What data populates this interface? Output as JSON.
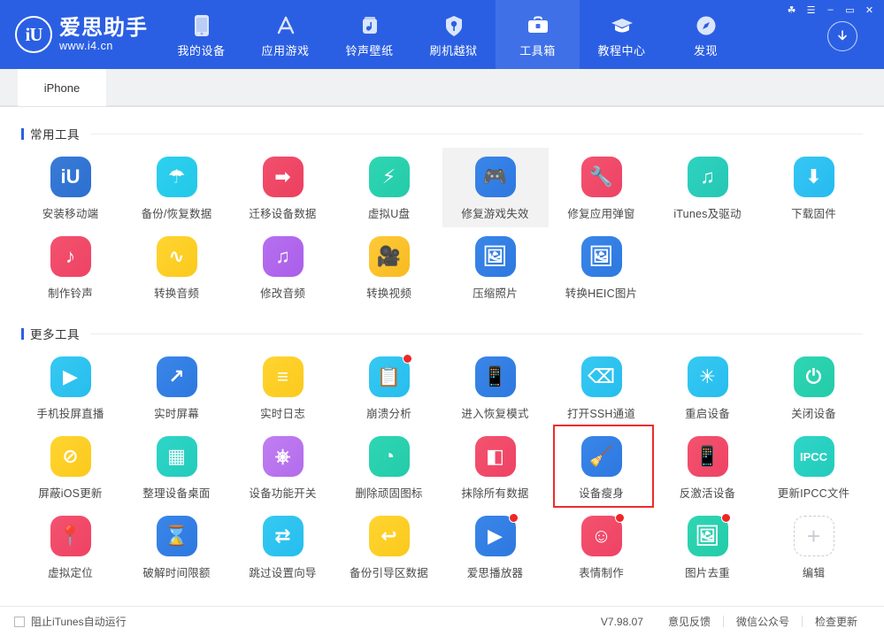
{
  "window": {
    "controls": [
      {
        "name": "skin-button",
        "glyph": "☘"
      },
      {
        "name": "menu-button",
        "glyph": "☰"
      },
      {
        "name": "minimize-button",
        "glyph": "–"
      },
      {
        "name": "maximize-button",
        "glyph": "▭"
      },
      {
        "name": "close-button",
        "glyph": "✕"
      }
    ]
  },
  "brand": {
    "mark": "iU",
    "name_cn": "爱思助手",
    "url": "www.i4.cn"
  },
  "nav": {
    "items": [
      {
        "label": "我的设备",
        "icon": "phone-icon",
        "active": false
      },
      {
        "label": "应用游戏",
        "icon": "appstore-icon",
        "active": false
      },
      {
        "label": "铃声壁纸",
        "icon": "music-icon",
        "active": false
      },
      {
        "label": "刷机越狱",
        "icon": "shield-icon",
        "active": false
      },
      {
        "label": "工具箱",
        "icon": "toolbox-icon",
        "active": true
      },
      {
        "label": "教程中心",
        "icon": "graduation-icon",
        "active": false
      },
      {
        "label": "发现",
        "icon": "compass-icon",
        "active": false
      }
    ],
    "download_button": "download-icon"
  },
  "tabs": [
    {
      "label": "iPhone",
      "active": true
    }
  ],
  "sections": [
    {
      "title": "常用工具",
      "items": [
        {
          "label": "安装移动端",
          "icon": "aisi-app-icon",
          "color1": "#3a7bd5",
          "color2": "#2b6fd1",
          "glyph": "iU",
          "badge": false,
          "hover": false,
          "selected": false
        },
        {
          "label": "备份/恢复数据",
          "icon": "umbrella-icon",
          "color1": "#2fd0ef",
          "color2": "#22c8e8",
          "glyph": "☂",
          "badge": false,
          "hover": false,
          "selected": false
        },
        {
          "label": "迁移设备数据",
          "icon": "migrate-icon",
          "color1": "#f2506e",
          "color2": "#ec3f5f",
          "glyph": "➡",
          "badge": false,
          "hover": false,
          "selected": false
        },
        {
          "label": "虚拟U盘",
          "icon": "usb-drive-icon",
          "color1": "#2fd6b4",
          "color2": "#23cba8",
          "glyph": "⚡",
          "badge": false,
          "hover": false,
          "selected": false
        },
        {
          "label": "修复游戏失效",
          "icon": "gamepad-icon",
          "color1": "#3a86e8",
          "color2": "#2d78e0",
          "glyph": "🎮",
          "badge": false,
          "hover": true,
          "selected": false
        },
        {
          "label": "修复应用弹窗",
          "icon": "repair-popup-icon",
          "color1": "#f4536f",
          "color2": "#ee4264",
          "glyph": "🔧",
          "badge": false,
          "hover": false,
          "selected": false
        },
        {
          "label": "iTunes及驱动",
          "icon": "itunes-icon",
          "color1": "#2fd2c0",
          "color2": "#25c7b4",
          "glyph": "♫",
          "badge": false,
          "hover": false,
          "selected": false
        },
        {
          "label": "下载固件",
          "icon": "download-firmware-icon",
          "color1": "#36c6f4",
          "color2": "#26bbef",
          "glyph": "⬇",
          "badge": false,
          "hover": false,
          "selected": false
        },
        {
          "label": "制作铃声",
          "icon": "ringtone-icon",
          "color1": "#f4536f",
          "color2": "#ee4264",
          "glyph": "♪",
          "badge": false,
          "hover": false,
          "selected": false
        },
        {
          "label": "转换音频",
          "icon": "audio-wave-icon",
          "color1": "#ffd531",
          "color2": "#fbc91c",
          "glyph": "∿",
          "badge": false,
          "hover": false,
          "selected": false
        },
        {
          "label": "修改音频",
          "icon": "edit-audio-icon",
          "color1": "#b770ef",
          "color2": "#a95ee9",
          "glyph": "♫",
          "badge": false,
          "hover": false,
          "selected": false
        },
        {
          "label": "转换视频",
          "icon": "convert-video-icon",
          "color1": "#ffc939",
          "color2": "#f8bb1f",
          "glyph": "🎥",
          "badge": false,
          "hover": false,
          "selected": false
        },
        {
          "label": "压缩照片",
          "icon": "compress-photo-icon",
          "color1": "#3a86e8",
          "color2": "#2d78e0",
          "glyph": "🖼",
          "badge": false,
          "hover": false,
          "selected": false
        },
        {
          "label": "转换HEIC图片",
          "icon": "convert-heic-icon",
          "color1": "#3a86e8",
          "color2": "#2d78e0",
          "glyph": "🖼",
          "badge": false,
          "hover": false,
          "selected": false
        }
      ]
    },
    {
      "title": "更多工具",
      "items": [
        {
          "label": "手机投屏直播",
          "icon": "screencast-icon",
          "color1": "#36c9f2",
          "color2": "#26bdee",
          "glyph": "▶",
          "badge": false,
          "hover": false,
          "selected": false
        },
        {
          "label": "实时屏幕",
          "icon": "realtime-screen-icon",
          "color1": "#3a86e8",
          "color2": "#2d78e0",
          "glyph": "↗",
          "badge": false,
          "hover": false,
          "selected": false
        },
        {
          "label": "实时日志",
          "icon": "realtime-log-icon",
          "color1": "#ffd531",
          "color2": "#fbc91c",
          "glyph": "≡",
          "badge": false,
          "hover": false,
          "selected": false
        },
        {
          "label": "崩溃分析",
          "icon": "crash-analysis-icon",
          "color1": "#36c9f2",
          "color2": "#26bdee",
          "glyph": "📋",
          "badge": true,
          "hover": false,
          "selected": false
        },
        {
          "label": "进入恢复模式",
          "icon": "recovery-mode-icon",
          "color1": "#3a86e8",
          "color2": "#2d78e0",
          "glyph": "📱",
          "badge": false,
          "hover": false,
          "selected": false
        },
        {
          "label": "打开SSH通道",
          "icon": "ssh-icon",
          "color1": "#36c9f2",
          "color2": "#26bdee",
          "glyph": "⌫",
          "badge": false,
          "hover": false,
          "selected": false
        },
        {
          "label": "重启设备",
          "icon": "restart-device-icon",
          "color1": "#36c9f2",
          "color2": "#26bdee",
          "glyph": "✳",
          "badge": false,
          "hover": false,
          "selected": false
        },
        {
          "label": "关闭设备",
          "icon": "shutdown-device-icon",
          "color1": "#2fd6b4",
          "color2": "#23cba8",
          "glyph": "⏻",
          "badge": false,
          "hover": false,
          "selected": false
        },
        {
          "label": "屏蔽iOS更新",
          "icon": "block-ios-update-icon",
          "color1": "#ffd531",
          "color2": "#fbc91c",
          "glyph": "⊘",
          "badge": false,
          "hover": false,
          "selected": false
        },
        {
          "label": "整理设备桌面",
          "icon": "arrange-desktop-icon",
          "color1": "#2fd6c8",
          "color2": "#23cbbb",
          "glyph": "▦",
          "badge": false,
          "hover": false,
          "selected": false
        },
        {
          "label": "设备功能开关",
          "icon": "device-switch-icon",
          "color1": "#c07ef2",
          "color2": "#b36cec",
          "glyph": "⎈",
          "badge": false,
          "hover": false,
          "selected": false
        },
        {
          "label": "删除顽固图标",
          "icon": "remove-icon-icon",
          "color1": "#2fd6b4",
          "color2": "#23cba8",
          "glyph": "◔",
          "badge": false,
          "hover": false,
          "selected": false
        },
        {
          "label": "抹除所有数据",
          "icon": "erase-data-icon",
          "color1": "#f4536f",
          "color2": "#ee4264",
          "glyph": "◧",
          "badge": false,
          "hover": false,
          "selected": false
        },
        {
          "label": "设备瘦身",
          "icon": "device-clean-icon",
          "color1": "#3a86e8",
          "color2": "#2d78e0",
          "glyph": "🧹",
          "badge": false,
          "hover": false,
          "selected": true
        },
        {
          "label": "反激活设备",
          "icon": "deactivate-device-icon",
          "color1": "#f4536f",
          "color2": "#ee4264",
          "glyph": "📱",
          "badge": false,
          "hover": false,
          "selected": false
        },
        {
          "label": "更新IPCC文件",
          "icon": "ipcc-icon",
          "color1": "#2fd6c8",
          "color2": "#23cbbb",
          "glyph": "IPCC",
          "badge": false,
          "hover": false,
          "selected": false
        },
        {
          "label": "虚拟定位",
          "icon": "virtual-location-icon",
          "color1": "#f4536f",
          "color2": "#ee4264",
          "glyph": "📍",
          "badge": false,
          "hover": false,
          "selected": false
        },
        {
          "label": "破解时间限额",
          "icon": "crack-screentime-icon",
          "color1": "#3a86e8",
          "color2": "#2d78e0",
          "glyph": "⌛",
          "badge": false,
          "hover": false,
          "selected": false
        },
        {
          "label": "跳过设置向导",
          "icon": "skip-setup-icon",
          "color1": "#36c9f2",
          "color2": "#26bdee",
          "glyph": "⇄",
          "badge": false,
          "hover": false,
          "selected": false
        },
        {
          "label": "备份引导区数据",
          "icon": "backup-boot-icon",
          "color1": "#ffd531",
          "color2": "#fbc91c",
          "glyph": "↩",
          "badge": false,
          "hover": false,
          "selected": false
        },
        {
          "label": "爱思播放器",
          "icon": "aisi-player-icon",
          "color1": "#3a86e8",
          "color2": "#2d78e0",
          "glyph": "▶",
          "badge": true,
          "hover": false,
          "selected": false
        },
        {
          "label": "表情制作",
          "icon": "emoji-maker-icon",
          "color1": "#f4536f",
          "color2": "#ee4264",
          "glyph": "☺",
          "badge": true,
          "hover": false,
          "selected": false
        },
        {
          "label": "图片去重",
          "icon": "photo-dedupe-icon",
          "color1": "#2fd6b4",
          "color2": "#23cba8",
          "glyph": "🖼",
          "badge": true,
          "hover": false,
          "selected": false
        },
        {
          "label": "编辑",
          "icon": "edit-add-icon",
          "color1": "",
          "color2": "",
          "glyph": "+",
          "badge": false,
          "hover": false,
          "selected": false,
          "dashed": true
        }
      ]
    }
  ],
  "statusbar": {
    "block_itunes_label": "阻止iTunes自动运行",
    "version": "V7.98.07",
    "feedback": "意见反馈",
    "wechat": "微信公众号",
    "check_update": "检查更新"
  },
  "colors": {
    "header_bg": "#2b5fe3",
    "nav_active_bg": "#3f70e8",
    "accent": "#2b5fe3",
    "selection_border": "#ee2b2b",
    "badge": "#ef2626"
  }
}
